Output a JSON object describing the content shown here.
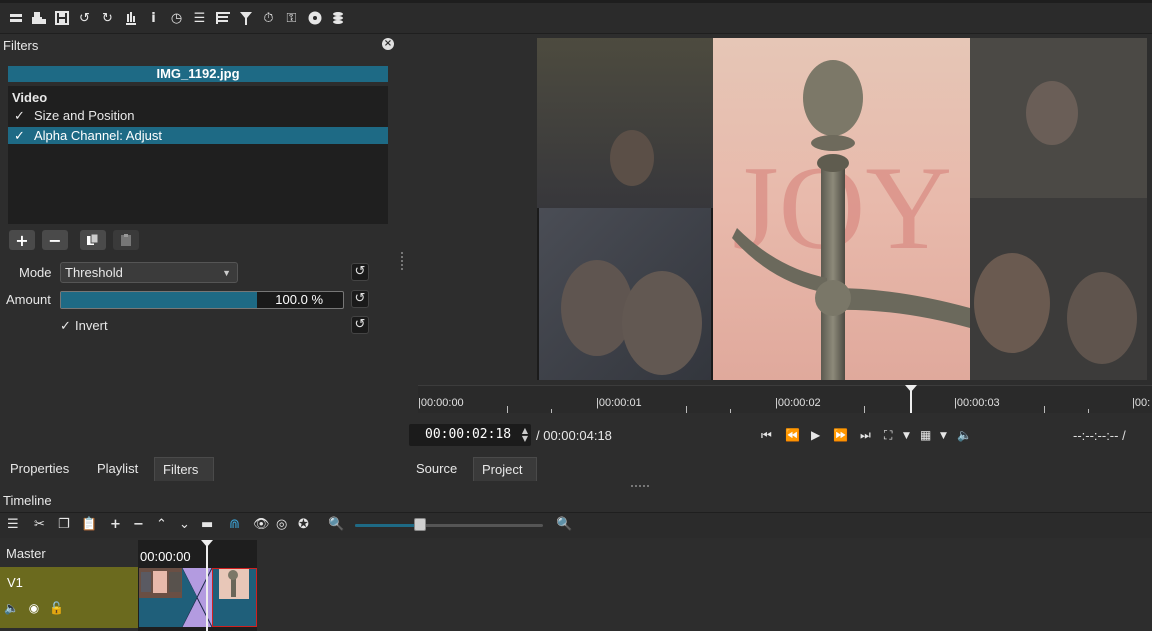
{
  "toolbar": {
    "icons": [
      "open-other-icon",
      "open-file-icon",
      "save-icon",
      "undo-icon",
      "redo-icon",
      "peak-meter-icon",
      "properties-icon",
      "recent-icon",
      "playlist-icon",
      "history-icon",
      "filters-icon",
      "jobs-icon",
      "keyframes-icon",
      "markers-icon",
      "notes-icon"
    ]
  },
  "filters": {
    "title": "Filters",
    "clip_name": "IMG_1192.jpg",
    "section": "Video",
    "items": [
      {
        "check": "✓",
        "label": "Size and Position",
        "selected": false
      },
      {
        "check": "✓",
        "label": "Alpha Channel: Adjust",
        "selected": true
      }
    ],
    "mode_label": "Mode",
    "mode_value": "Threshold",
    "amount_label": "Amount",
    "amount_value": "100.0 %",
    "amount_fraction": 1.0,
    "invert_check": "✓",
    "invert_label": "Invert"
  },
  "left_tabs": [
    "Properties",
    "Playlist",
    "Filters"
  ],
  "right_tabs": [
    "Source",
    "Project"
  ],
  "ruler": {
    "labels": [
      "|00:00:00",
      "|00:00:01",
      "|00:00:02",
      "|00:00:03",
      "|00:"
    ]
  },
  "transport": {
    "timecode": "00:00:02:18",
    "total": "/ 00:00:04:18",
    "in_out": "--:--:--:-- /"
  },
  "timeline": {
    "title": "Timeline",
    "master_label": "Master",
    "track_name": "V1",
    "time_label": "00:00:00"
  },
  "colors": {
    "accent": "#1e6a85",
    "track_header": "#6b6a1e",
    "clip_blue": "#1f5f7a",
    "transition_purple": "#b39be0",
    "selected_clip_border": "#d02020"
  }
}
